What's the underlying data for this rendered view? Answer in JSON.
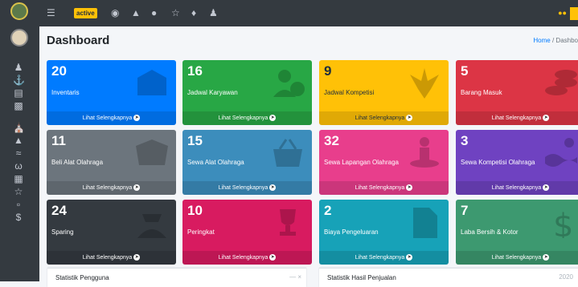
{
  "topbar": {
    "active_label": "active"
  },
  "header": {
    "title": "Dashboard",
    "breadcrumb_home": "Home",
    "breadcrumb_sep": " / ",
    "breadcrumb_current": "Dashbo"
  },
  "boxes": [
    {
      "number": "20",
      "label": "Inventaris",
      "footer": "Lihat Selengkapnya",
      "color": "#007bff",
      "icon": "tags-icon"
    },
    {
      "number": "16",
      "label": "Jadwal Karyawan",
      "footer": "Lihat Selengkapnya",
      "color": "#28a745",
      "icon": "user-clock-icon"
    },
    {
      "number": "9",
      "label": "Jadwal Kompetisi",
      "footer": "Lihat Selengkapnya",
      "color": "#ffc107",
      "icon": "jedi-icon"
    },
    {
      "number": "5",
      "label": "Barang Masuk",
      "footer": "Lihat Selengkapnya",
      "color": "#dc3545",
      "icon": "coins-icon"
    },
    {
      "number": "11",
      "label": "Beli Alat Olahraga",
      "footer": "Lihat Selengkapnya",
      "color": "#6c757d",
      "icon": "box-open-icon"
    },
    {
      "number": "15",
      "label": "Sewa Alat Olahraga",
      "footer": "Lihat Selengkapnya",
      "color": "#3c8dbc",
      "icon": "basket-icon"
    },
    {
      "number": "32",
      "label": "Sewa Lapangan Olahraga",
      "footer": "Lihat Selengkapnya",
      "color": "#e83e8c",
      "icon": "street-view-icon"
    },
    {
      "number": "3",
      "label": "Sewa Kompetisi Olahraga",
      "footer": "Lihat Selengkapnya",
      "color": "#6f42c1",
      "icon": "swimmer-icon"
    },
    {
      "number": "24",
      "label": "Sparing",
      "footer": "Lihat Selengkapnya",
      "color": "#343a40",
      "icon": "user-secret-icon"
    },
    {
      "number": "10",
      "label": "Peringkat",
      "footer": "Lihat Selengkapnya",
      "color": "#d81b60",
      "icon": "trophy-icon"
    },
    {
      "number": "2",
      "label": "Biaya Pengeluaran",
      "footer": "Lihat Selengkapnya",
      "color": "#17a2b8",
      "icon": "file-invoice-dollar-icon"
    },
    {
      "number": "7",
      "label": "Laba Bersih & Kotor",
      "footer": "Lihat Selengkapnya",
      "color": "#3d9970",
      "icon": "dollar-sign-icon"
    }
  ],
  "cards": [
    {
      "title": "Statistik Pengguna",
      "tools": "—   ×"
    },
    {
      "title": "Statistik Hasil Penjualan",
      "tools": "2020"
    }
  ]
}
